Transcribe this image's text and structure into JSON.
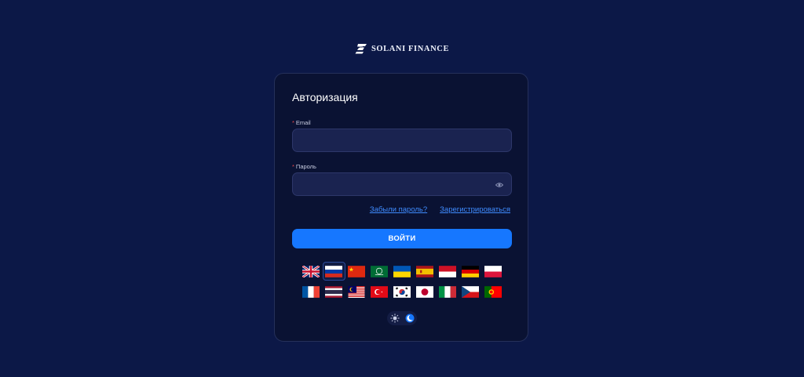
{
  "brand": {
    "name": "SOLANI FINANCE",
    "logo_icon": "solani-s-logo"
  },
  "form": {
    "title": "Авторизация",
    "required_marker": "*",
    "email": {
      "label": "Email",
      "value": "",
      "placeholder": ""
    },
    "password": {
      "label": "Пароль",
      "value": "",
      "placeholder": "",
      "icon": "eye-icon"
    },
    "forgot_link": "Забыли пароль?",
    "register_link": "Зарегистрироваться",
    "submit_label": "ВОЙТИ"
  },
  "languages": {
    "selected": "ru",
    "row1": [
      "gb",
      "ru",
      "cn",
      "sa",
      "ua",
      "es",
      "id",
      "de",
      "pl"
    ],
    "row2": [
      "fr",
      "th",
      "my",
      "tr",
      "kr",
      "jp",
      "it",
      "cz",
      "pt"
    ]
  },
  "theme": {
    "options": [
      "sun-icon",
      "moon-icon"
    ],
    "active": "moon-icon"
  },
  "colors": {
    "background": "#0c1847",
    "card": "#0a1233",
    "accent": "#1677ff",
    "link": "#3f8cff"
  }
}
